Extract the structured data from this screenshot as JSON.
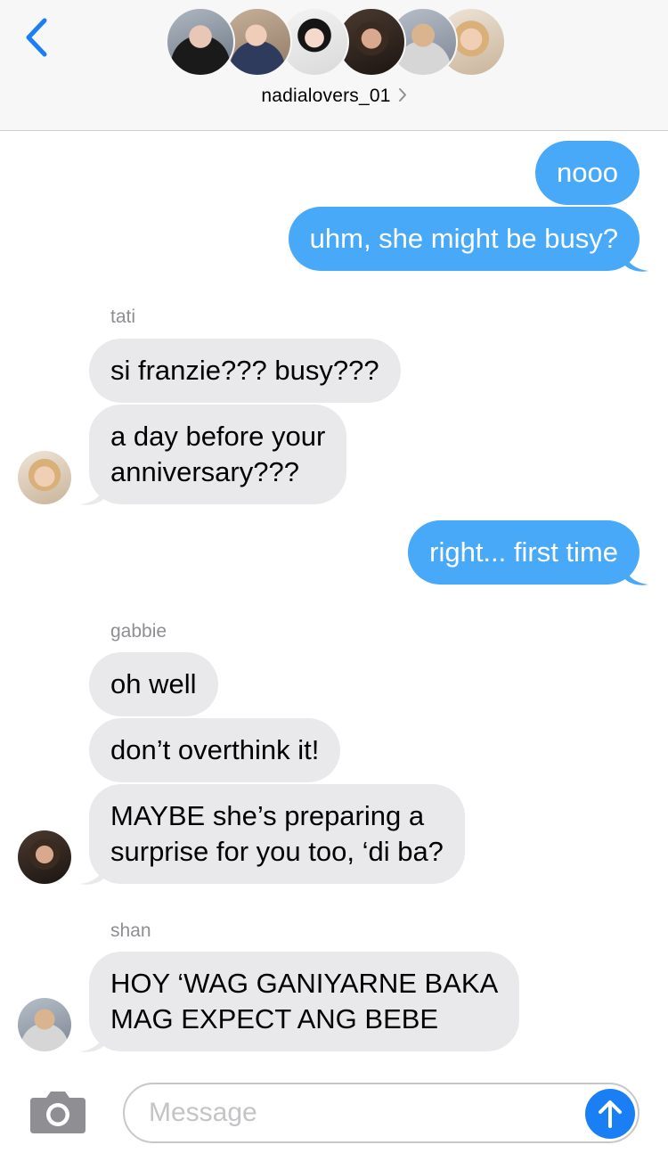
{
  "header": {
    "group_name": "nadialovers_01",
    "back_icon": "chevron-left-icon",
    "chevron_icon": "chevron-right-icon",
    "accent_color": "#1a7ff5",
    "member_avatars": [
      "avatar-1",
      "avatar-2",
      "avatar-3",
      "avatar-4",
      "avatar-5",
      "avatar-6"
    ]
  },
  "messages": {
    "m1": {
      "text": "nooo",
      "direction": "sent"
    },
    "m2": {
      "text": "uhm, she might be busy?",
      "direction": "sent"
    },
    "tati": {
      "sender": "tati",
      "m3": "si franzie??? busy???",
      "m4_line1": "a day before your",
      "m4_line2": "anniversary???"
    },
    "m5": {
      "text": "right... first time",
      "direction": "sent"
    },
    "gabbie": {
      "sender": "gabbie",
      "m6": "oh well",
      "m7": "don’t overthink it!",
      "m8_line1": "MAYBE she’s preparing a",
      "m8_line2": "surprise for you too, ‘di ba?"
    },
    "shan": {
      "sender": "shan",
      "m9_line1": "HOY ‘WAG GANIYARNE BAKA",
      "m9_line2": "MAG EXPECT ANG BEBE"
    },
    "sent_color": "#48a9f8",
    "received_color": "#e9e9eb"
  },
  "composer": {
    "placeholder": "Message",
    "value": "",
    "camera_icon": "camera-icon",
    "send_icon": "arrow-up-icon"
  }
}
